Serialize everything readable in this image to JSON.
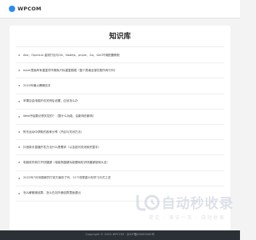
{
  "header": {
    "logo_text": "WPCOM"
  },
  "main": {
    "title": "知识库",
    "items": [
      {
        "label": "Abc、OpenLst 量测打包与Git、Nodejs、pnpm、Go、GoC环境配置教程"
      },
      {
        "label": "excel里面所有重复项不删除只标重复数据（整个表格全部匹配所有行列）"
      },
      {
        "label": "2023年最火爆微信手"
      },
      {
        "label": "苹果自由电脑开设关侧后设置，应该怎么办"
      },
      {
        "label": "Web开始要记得关控的？（整什么功能，会影响的影响）"
      },
      {
        "label": "陈东运动中获取的各种分享（开启与关闭方法）"
      },
      {
        "label": "抖音新手直播开发方法什么是需求（以及如何关闭就完整手）"
      },
      {
        "label": "电脑软件新打开快捷键（电脑快捷键功能基础知识快捷键使用大全）"
      },
      {
        "label": "2022年7月份搬家的打官方面前了吗，12个或是重计划学习分式之选"
      },
      {
        "label": "怎么解散微信群，怎么在另外微信群里面退出"
      }
    ]
  },
  "footer": {
    "text": "Copyright © 2023 WPCOM  ·  京ICP备00000000号"
  },
  "watermark": {
    "title": "自动秒收录",
    "subtitle": "提交 · 来访一次 · 自动收录"
  },
  "colors": {
    "accent": "#2d8cf0",
    "page_bg": "#f3f3f3",
    "footer_bg": "#2b2f36"
  }
}
